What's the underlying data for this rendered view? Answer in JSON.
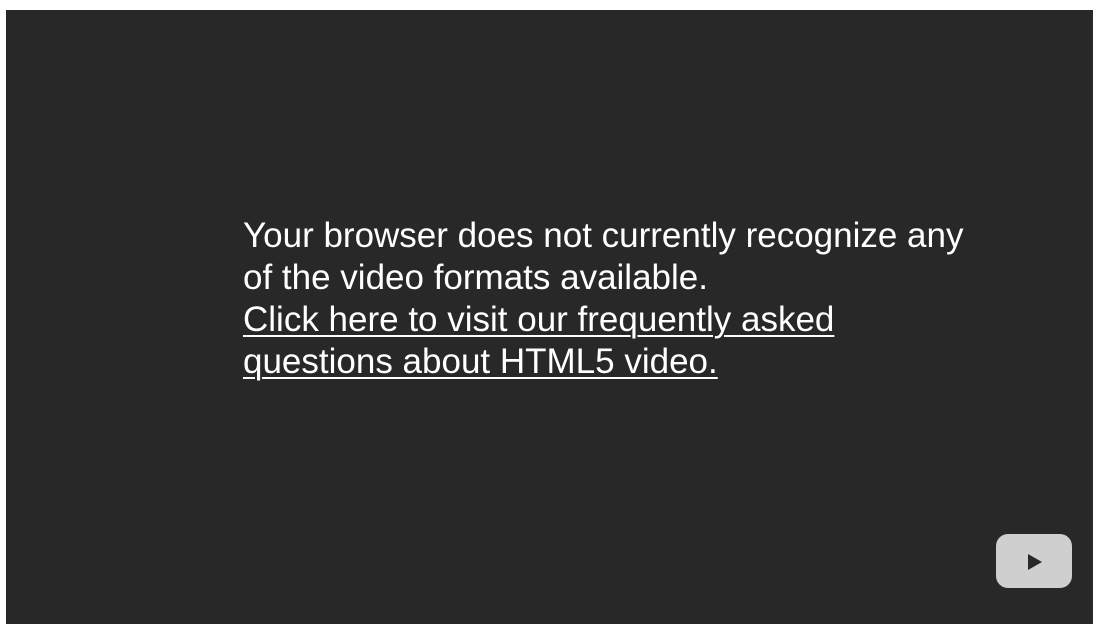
{
  "message": {
    "line1": "Your browser does not currently recognize any",
    "line2": "of the video formats available.",
    "link_line1": "Click here to visit our frequently asked",
    "link_line2": "questions about HTML5 video."
  },
  "controls": {
    "play_icon": "play-icon"
  },
  "colors": {
    "background": "#282828",
    "text": "#ffffff",
    "play_button": "#cfcfcf",
    "play_glyph": "#282828"
  }
}
